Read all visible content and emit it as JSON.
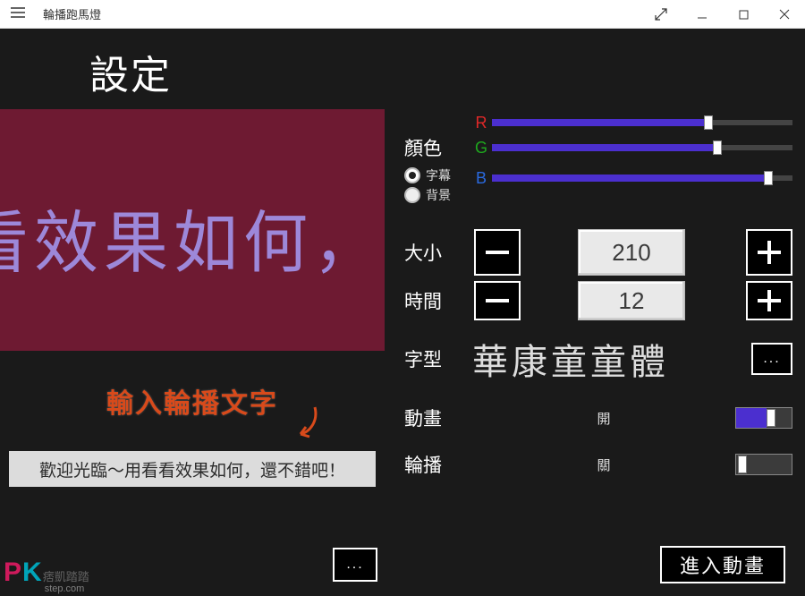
{
  "window": {
    "title": "輪播跑馬燈"
  },
  "heading": "設定",
  "preview": {
    "scroll_text": "看效果如何，"
  },
  "instruction_label": "輸入輪播文字",
  "caption_input_value": "歡迎光臨～用看看效果如何，還不錯吧！",
  "color": {
    "label": "顏色",
    "r": {
      "letter": "R",
      "pct": 72
    },
    "g": {
      "letter": "G",
      "pct": 75
    },
    "b": {
      "letter": "B",
      "pct": 92
    },
    "radio_subtitle": "字幕",
    "radio_background": "背景",
    "selected": "subtitle"
  },
  "size": {
    "label": "大小",
    "value": "210"
  },
  "time": {
    "label": "時間",
    "value": "12"
  },
  "font": {
    "label": "字型",
    "name": "華康童童體"
  },
  "anim": {
    "label": "動畫",
    "state_text": "開",
    "on": true
  },
  "loop": {
    "label": "輪播",
    "state_text": "關",
    "on": false
  },
  "go_button": "進入動畫",
  "watermark": {
    "p": "P",
    "k": "K",
    "cjk": "痞凱踏踏",
    "sub": "step.com"
  }
}
